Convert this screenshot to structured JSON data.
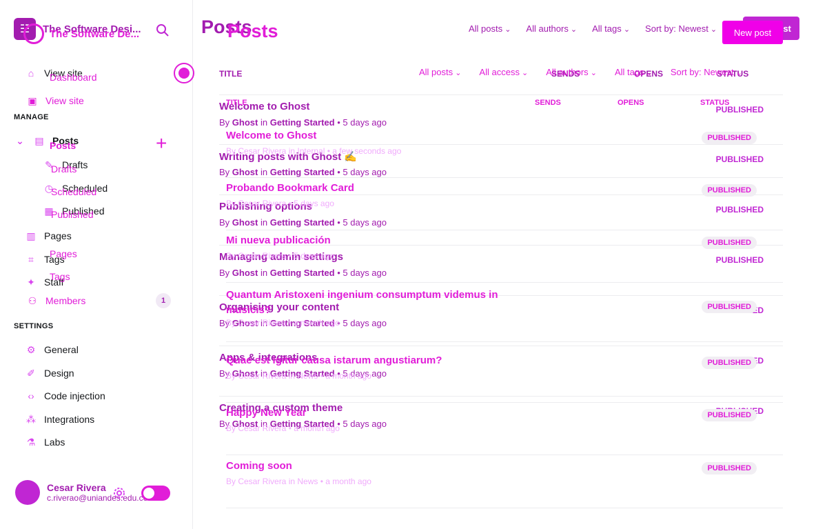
{
  "colors": {
    "accent": "#c026d3",
    "pink": "#e11dd8",
    "text": "#15171a"
  },
  "site": {
    "title_a": "The Software Desi...",
    "title_b": "The Software De..."
  },
  "sidebar": {
    "view_site": "View site",
    "manage_label": "MANAGE",
    "settings_label": "SETTINGS",
    "posts": "Posts",
    "drafts": "Drafts",
    "scheduled": "Scheduled",
    "published": "Published",
    "pages": "Pages",
    "tags": "Tags",
    "staff": "Staff",
    "settings_items": [
      "General",
      "Design",
      "Code injection",
      "Integrations",
      "Labs"
    ],
    "b_items": {
      "dashboard": "Dashboard",
      "view_site": "View site",
      "posts": "Posts",
      "drafts": "Drafts",
      "scheduled": "Scheduled",
      "published": "Published",
      "pages": "Pages",
      "tags": "Tags",
      "members": "Members",
      "members_count": "1"
    }
  },
  "user": {
    "name": "Cesar Rivera",
    "email": "c.riverao@uniandes.edu.co"
  },
  "main_a": {
    "title": "Posts",
    "filters": [
      "All posts",
      "All authors",
      "All tags",
      "Sort by: Newest"
    ],
    "new_post": "New post",
    "columns": {
      "title": "TITLE",
      "sends": "SENDS",
      "opens": "OPENS",
      "status": "STATUS"
    },
    "rows": [
      {
        "title": "Welcome to Ghost",
        "author": "Ghost",
        "tag": "Getting Started",
        "time": "5 days ago",
        "status": "PUBLISHED"
      },
      {
        "title": "Writing posts with Ghost ✍️",
        "author": "Ghost",
        "tag": "Getting Started",
        "time": "5 days ago",
        "status": "PUBLISHED"
      },
      {
        "title": "Publishing options",
        "author": "Ghost",
        "tag": "Getting Started",
        "time": "5 days ago",
        "status": "PUBLISHED"
      },
      {
        "title": "Managing admin settings",
        "author": "Ghost",
        "tag": "Getting Started",
        "time": "5 days ago",
        "status": "PUBLISHED"
      },
      {
        "title": "Organising your content",
        "author": "Ghost",
        "tag": "Getting Started",
        "time": "5 days ago",
        "status": "PUBLISHED"
      },
      {
        "title": "Apps & integrations",
        "author": "Ghost",
        "tag": "Getting Started",
        "time": "5 days ago",
        "status": "PUBLISHED"
      },
      {
        "title": "Creating a custom theme",
        "author": "Ghost",
        "tag": "Getting Started",
        "time": "5 days ago",
        "status": "PUBLISHED"
      }
    ]
  },
  "main_b": {
    "title": "Posts",
    "filters": [
      "All posts",
      "All access",
      "All authors",
      "All tags",
      "Sort by: Newest"
    ],
    "new_post": "New post",
    "columns": {
      "title": "TITLE",
      "sends": "SENDS",
      "opens": "OPENS",
      "status": "STATUS"
    },
    "rows": [
      {
        "title": "Welcome to Ghost",
        "meta": "By Cesar Rivera in Internal • a few seconds ago",
        "status": "PUBLISHED"
      },
      {
        "title": "Probando Bookmark Card",
        "meta": "By Cesar Rivera • 5 days ago",
        "status": "PUBLISHED"
      },
      {
        "title": "Mi nueva publicación",
        "meta": "By Cesar Rivera • 5 days ago",
        "status": "PUBLISHED"
      },
      {
        "title": "Quantum Aristoxeni ingenium consumptum videmus in musicis?",
        "meta": "By Cesar Rivera • a month ago",
        "status": "PUBLISHED"
      },
      {
        "title": "Quae est igitur causa istarum angustiarum?",
        "meta": "By Cesar Rivera in News • a month ago",
        "status": "PUBLISHED"
      },
      {
        "title": "Happy New Year",
        "meta": "By Cesar Rivera • a month ago",
        "status": "PUBLISHED"
      },
      {
        "title": "Coming soon",
        "meta": "By Cesar Rivera in News • a month ago",
        "status": "PUBLISHED"
      }
    ]
  }
}
